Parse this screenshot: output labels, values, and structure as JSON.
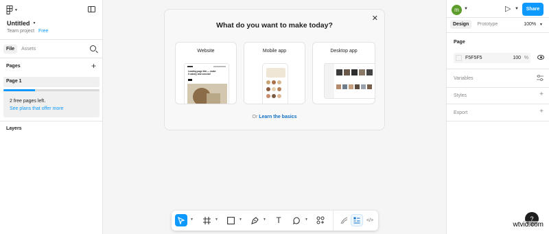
{
  "file": {
    "title": "Untitled",
    "project": "Team project",
    "plan_badge": "Free"
  },
  "left_panel": {
    "tabs": [
      "File",
      "Assets"
    ],
    "pages_header": "Pages",
    "pages": [
      "Page 1"
    ],
    "plans_line": "2 free pages left.",
    "plans_link": "See plans that offer more",
    "plans_progress": 0.33,
    "layers_header": "Layers"
  },
  "right_panel": {
    "avatar_letter": "m",
    "share_label": "Share",
    "tabs": [
      "Design",
      "Prototype"
    ],
    "zoom": "100%",
    "page_section": "Page",
    "page_color_hex": "F5F5F5",
    "page_opacity": "100",
    "page_opacity_unit": "%",
    "variables_label": "Variables",
    "styles_label": "Styles",
    "export_label": "Export",
    "help_label": "?"
  },
  "modal": {
    "title": "What do you want to make today?",
    "cards": [
      {
        "label": "Website"
      },
      {
        "label": "Mobile app"
      },
      {
        "label": "Desktop app"
      }
    ],
    "thumb_heading": "Landing page title — make it catchy and concise!",
    "learn_prefix": "Or",
    "learn_link": "Learn the basics"
  },
  "watermark": "wtvid.com",
  "colors": {
    "accent": "#0d99ff",
    "avatar": "#5c9c2a",
    "canvas": "#f5f5f5"
  },
  "toolbar": {
    "tools": [
      "move-tool",
      "frame-tool",
      "shape-tool",
      "pen-tool",
      "text-tool",
      "comment-tool",
      "actions-tool"
    ],
    "modes": [
      "draw-mode",
      "design-mode",
      "dev-mode"
    ],
    "text_tool_glyph": "T"
  }
}
